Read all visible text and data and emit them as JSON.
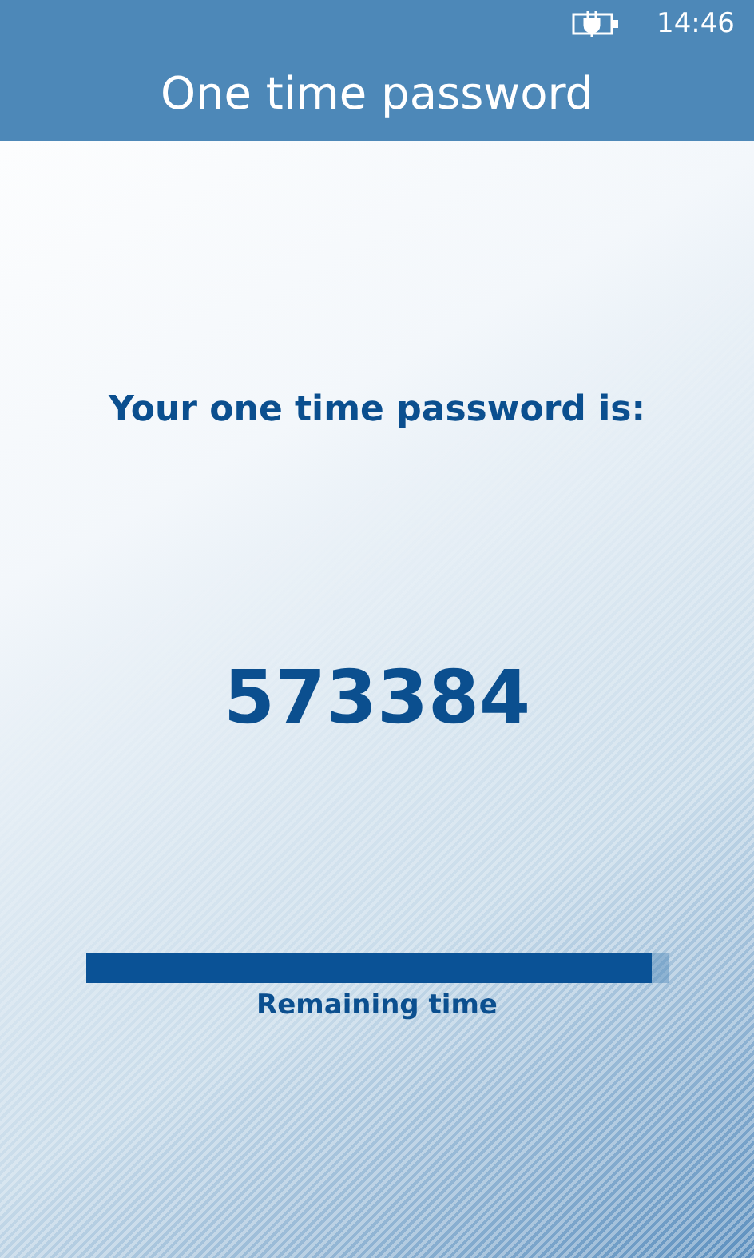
{
  "status_bar": {
    "time": "14:46"
  },
  "header": {
    "title": "One time password"
  },
  "heading": "Your one time password is:",
  "password": "573384",
  "timer": {
    "level": 0.97,
    "label": "Remaining time"
  }
}
